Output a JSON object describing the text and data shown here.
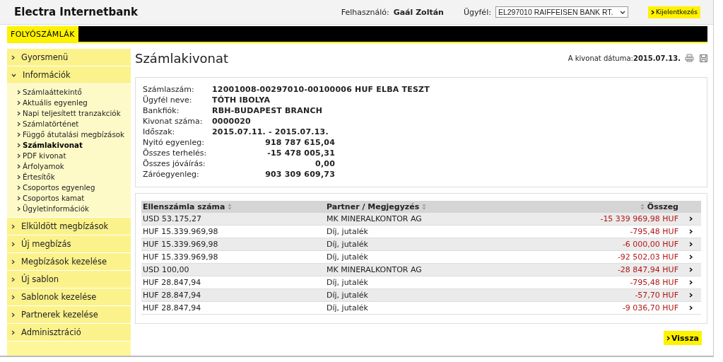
{
  "header": {
    "title": "Electra Internetbank",
    "user_label": "Felhasználó:",
    "user_name": "Gaál Zoltán",
    "client_label": "Ügyfél:",
    "client_select": "EL297010 RAIFFEISEN BANK RT.",
    "logout": "Kijelentkezés"
  },
  "tabs": [
    {
      "label": "FOLYÓSZÁMLÁK",
      "selected": true
    }
  ],
  "sidebar": {
    "items": [
      {
        "label": "Gyorsmenü",
        "expanded": false
      },
      {
        "label": "Információk",
        "expanded": true,
        "children": [
          {
            "label": "Számlaáttekintő",
            "selected": false
          },
          {
            "label": "Aktuális egyenleg",
            "selected": false
          },
          {
            "label": "Napi teljesített tranzakciók",
            "selected": false
          },
          {
            "label": "Számlatörténet",
            "selected": false
          },
          {
            "label": "Függő átutalási megbízások",
            "selected": false
          },
          {
            "label": "Számlakivonat",
            "selected": true
          },
          {
            "label": "PDF kivonat",
            "selected": false
          },
          {
            "label": "Árfolyamok",
            "selected": false
          },
          {
            "label": "Értesítők",
            "selected": false
          },
          {
            "label": "Csoportos egyenleg",
            "selected": false
          },
          {
            "label": "Csoportos kamat",
            "selected": false
          },
          {
            "label": "Ügyletinformációk",
            "selected": false
          }
        ]
      },
      {
        "label": "Elküldött megbízások",
        "expanded": false
      },
      {
        "label": "Új megbízás",
        "expanded": false
      },
      {
        "label": "Megbízások kezelése",
        "expanded": false
      },
      {
        "label": "Új sablon",
        "expanded": false
      },
      {
        "label": "Sablonok kezelése",
        "expanded": false
      },
      {
        "label": "Partnerek kezelése",
        "expanded": false
      },
      {
        "label": "Adminisztráció",
        "expanded": false
      }
    ]
  },
  "page": {
    "title": "Számlakivonat",
    "date_label": "A kivonat dátuma:",
    "date": "2015.07.13."
  },
  "details": [
    {
      "label": "Számlaszám:",
      "value": "12001008-00297010-00100006 HUF ELBA TESZT",
      "kind": "text"
    },
    {
      "label": "Ügyfél neve:",
      "value": "TÓTH IBOLYA",
      "kind": "text"
    },
    {
      "label": "Bankfiók:",
      "value": "RBH-BUDAPEST BRANCH",
      "kind": "text"
    },
    {
      "label": "Kivonat száma:",
      "value": "0000020",
      "kind": "text"
    },
    {
      "label": "Időszak:",
      "value": "2015.07.11. - 2015.07.13.",
      "kind": "text"
    },
    {
      "label": "Nyitó egyenleg:",
      "value": "918 787 615,04",
      "kind": "amount"
    },
    {
      "label": "Összes terhelés:",
      "value": "-15 478 005,31",
      "kind": "amount"
    },
    {
      "label": "Összes jóváírás:",
      "value": "0,00",
      "kind": "amount"
    },
    {
      "label": "Záróegyenleg:",
      "value": "903 309 609,73",
      "kind": "amount"
    }
  ],
  "table": {
    "columns": [
      "Ellenszámla száma",
      "Partner / Megjegyzés",
      "Összeg"
    ],
    "rows": [
      [
        "USD 53.175,27",
        "MK MINERALKONTOR AG",
        "-15 339 969,98 HUF"
      ],
      [
        "HUF 15.339.969,98",
        "Díj, jutalék",
        "-795,48 HUF"
      ],
      [
        "HUF 15.339.969,98",
        "Díj, jutalék",
        "-6 000,00 HUF"
      ],
      [
        "HUF 15.339.969,98",
        "Díj, jutalék",
        "-92 502,03 HUF"
      ],
      [
        "USD 100,00",
        "MK MINERALKONTOR AG",
        "-28 847,94 HUF"
      ],
      [
        "HUF 28.847,94",
        "Díj, jutalék",
        "-795,48 HUF"
      ],
      [
        "HUF 28.847,94",
        "Díj, jutalék",
        "-57,70 HUF"
      ],
      [
        "HUF 28.847,94",
        "Díj, jutalék",
        "-9 036,70 HUF"
      ]
    ]
  },
  "back_button": "Vissza"
}
